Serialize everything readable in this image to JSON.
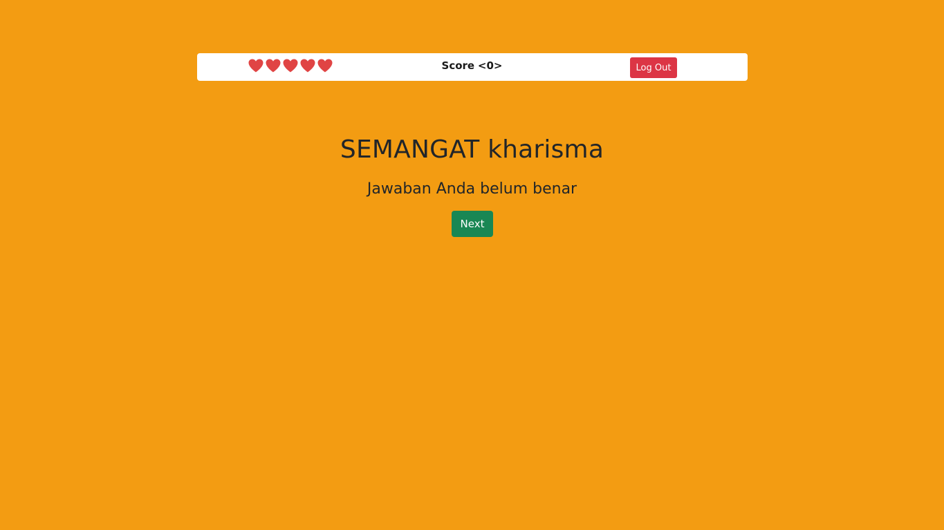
{
  "header": {
    "lives": [
      "heart",
      "heart",
      "heart",
      "heart",
      "heart"
    ],
    "score_label": "Score",
    "score_value": "<0>",
    "logout_label": "Log Out"
  },
  "main": {
    "title": "SEMANGAT kharisma",
    "subtitle": "Jawaban Anda belum benar",
    "next_label": "Next"
  },
  "colors": {
    "background": "#f39c12",
    "heart": "#e04444",
    "logout": "#dc3545",
    "next": "#198754"
  }
}
